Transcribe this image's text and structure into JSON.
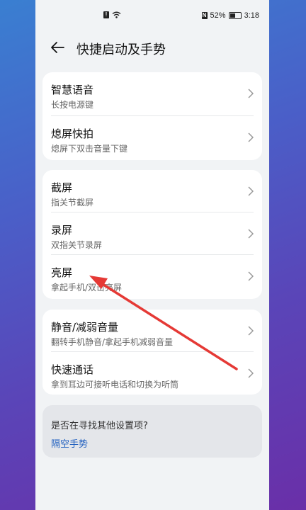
{
  "status": {
    "battery": "52%",
    "time": "3:18"
  },
  "header": {
    "title": "快捷启动及手势"
  },
  "groups": [
    {
      "items": [
        {
          "label": "智慧语音",
          "sub": "长按电源键"
        },
        {
          "label": "熄屏快拍",
          "sub": "熄屏下双击音量下键"
        }
      ]
    },
    {
      "items": [
        {
          "label": "截屏",
          "sub": "指关节截屏"
        },
        {
          "label": "录屏",
          "sub": "双指关节录屏"
        },
        {
          "label": "亮屏",
          "sub": "拿起手机/双击亮屏"
        }
      ]
    },
    {
      "items": [
        {
          "label": "静音/减弱音量",
          "sub": "翻转手机静音/拿起手机减弱音量"
        },
        {
          "label": "快速通话",
          "sub": "拿到耳边可接听电话和切换为听筒"
        }
      ]
    }
  ],
  "search": {
    "question": "是否在寻找其他设置项?",
    "link": "隔空手势"
  },
  "colors": {
    "accent": "#1f5fbf",
    "annotation_arrow": "#e53935"
  }
}
